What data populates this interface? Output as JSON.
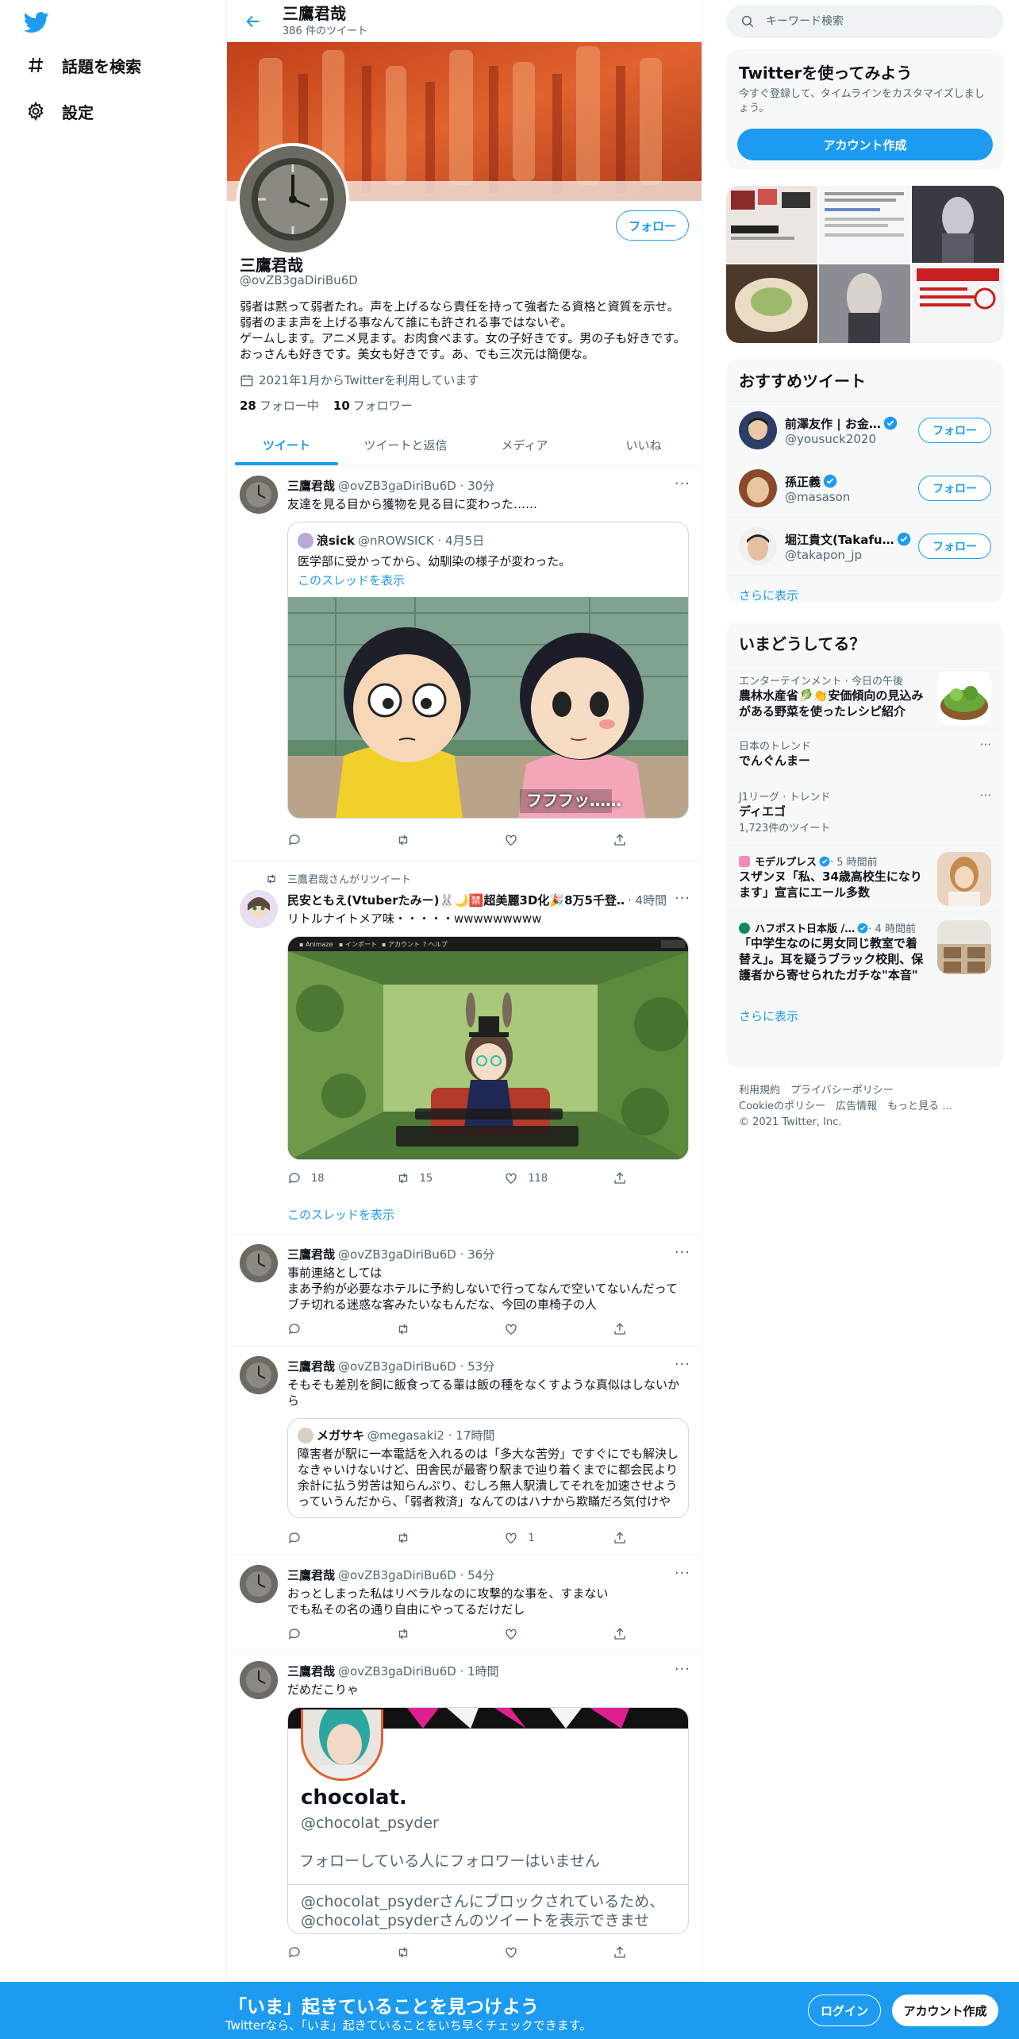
{
  "nav": {
    "explore": "話題を検索",
    "settings": "設定"
  },
  "profile": {
    "name": "三鷹君哉",
    "tweet_count": "386 件のツイート",
    "handle": "@ovZB3gaDiriBu6D",
    "follow": "フォロー",
    "bio": "弱者は黙って弱者たれ。声を上げるなら責任を持って強者たる資格と資質を示せ。\n弱者のまま声を上げる事なんて誰にも許される事ではないぞ。\nゲームします。アニメ見ます。お肉食べます。女の子好きです。男の子も好きです。おっさんも好きです。美女も好きです。あ、でも三次元は簡便な。",
    "joined": "2021年1月からTwitterを利用しています",
    "following_count": "28",
    "following_label": "フォロー中",
    "followers_count": "10",
    "followers_label": "フォロワー"
  },
  "tabs": [
    "ツイート",
    "ツイートと返信",
    "メディア",
    "いいね"
  ],
  "tweets": [
    {
      "name": "三鷹君哉",
      "meta": "@ovZB3gaDiriBu6D · 30分",
      "text": "友達を見る目から獲物を見る目に変わった……",
      "quote": {
        "name": "浪sick",
        "meta": "@nROWSICK · 4月5日",
        "text": "医学部に受かってから、幼馴染の様子が変わった。",
        "thread": "このスレッドを表示",
        "caption": "フフフッ……"
      }
    },
    {
      "retweet_label": "三鷹君哉さんがリツイート",
      "name": "民安ともえ(Vtuberたみー)🐰🌙🈲超美麗3D化🎉8万5千登…",
      "meta": "· 4時間",
      "text": "リトルナイトメア味・・・・・wwwwwwwww",
      "replies": "18",
      "retweets": "15",
      "likes": "118",
      "thread": "このスレッドを表示"
    },
    {
      "name": "三鷹君哉",
      "meta": "@ovZB3gaDiriBu6D · 36分",
      "text": "事前連絡としては\nまあ予約が必要なホテルに予約しないで行ってなんで空いてないんだってブチ切れる迷惑な客みたいなもんだな、今回の車椅子の人"
    },
    {
      "name": "三鷹君哉",
      "meta": "@ovZB3gaDiriBu6D · 53分",
      "text": "そもそも差別を飼に飯食ってる輩は飯の種をなくすような真似はしないから",
      "likes": "1",
      "quote": {
        "name": "メガサキ",
        "meta": "@megasaki2 · 17時間",
        "text": "障害者が駅に一本電話を入れるのは「多大な苦労」ですぐにでも解決しなきゃいけないけど、田舎民が最寄り駅まで辿り着くまでに都会民より余計に払う労苦は知らんぷり、むしろ無人駅潰してそれを加速させようっていうんだから、「弱者救済」なんてのはハナから欺瞞だろ気付けや"
      }
    },
    {
      "name": "三鷹君哉",
      "meta": "@ovZB3gaDiriBu6D · 54分",
      "text": "おっとしまった私はリベラルなのに攻撃的な事を、すまない\nでも私その名の通り自由にやってるだけだし"
    },
    {
      "name": "三鷹君哉",
      "meta": "@ovZB3gaDiriBu6D · 1時間",
      "text": "だめだこりゃ",
      "card": {
        "name": "chocolat.",
        "handle": "@chocolat_psyder",
        "no_followers": "フォローしている人にフォロワーはいません",
        "blocked": "@chocolat_psyderさんにブロックされているため、@chocolat_psyderさんのツイートを表示できませ"
      }
    }
  ],
  "right": {
    "search_placeholder": "キーワード検索",
    "signup_title": "Twitterを使ってみよう",
    "signup_sub": "今すぐ登録して、タイムラインをカスタマイズしましょう。",
    "signup_button": "アカウント作成",
    "rec_title": "おすすめツイート",
    "recs": [
      {
        "name": "前澤友作 | お金…",
        "handle": "@yousuck2020"
      },
      {
        "name": "孫正義",
        "handle": "@masason"
      },
      {
        "name": "堀江貴文(Takafu…",
        "handle": "@takapon_jp"
      }
    ],
    "follow": "フォロー",
    "show_more": "さらに表示",
    "trends_title": "いまどうしてる？",
    "trends": [
      {
        "ctx": "エンターテインメント · 今日の午後",
        "title": "農林水産省🥬👏安価傾向の見込みがある野菜を使ったレシピ紹介"
      },
      {
        "ctx": "日本のトレンド",
        "title": "でんぐんまー"
      },
      {
        "ctx": "J1リーグ · トレンド",
        "title": "ディエゴ",
        "count": "1,723件のツイート"
      },
      {
        "ctx": "モデルプレス",
        "ctx_time": " · 5 時間前",
        "title": "スザンヌ「私、34歳高校生になります」宣言にエール多数"
      },
      {
        "ctx": "ハフポスト日本版 /…",
        "ctx_time": " · 4 時間前",
        "title": "「中学生なのに男女同じ教室で着替え」。耳を疑うブラック校則、保護者から寄せられたガチな\"本音\""
      }
    ],
    "footer_1": "利用規約　プライバシーポリシー",
    "footer_2": "Cookieのポリシー　広告情報　もっと見る …",
    "footer_3": "© 2021 Twitter, Inc."
  },
  "bottom": {
    "title": "「いま」起きていることを見つけよう",
    "sub": "Twitterなら、「いま」起きていることをいち早くチェックできます。",
    "login": "ログイン",
    "signup": "アカウント作成"
  },
  "colors": {
    "accent": "#1d9bf0",
    "text": "#0f1419",
    "muted": "#536471"
  }
}
